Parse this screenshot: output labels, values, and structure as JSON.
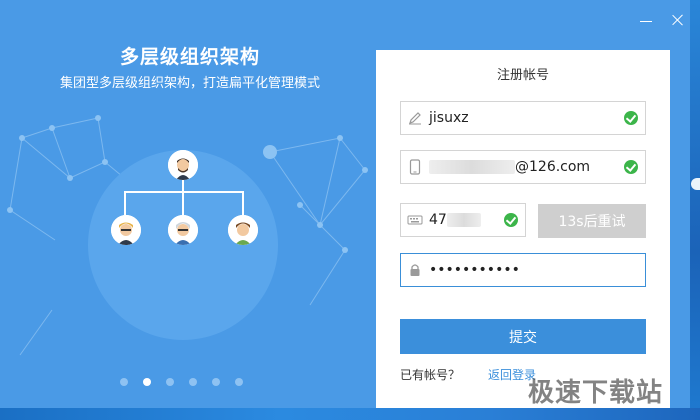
{
  "window": {
    "controls": {
      "minimize": "minimize-icon",
      "close": "close-icon"
    }
  },
  "hero": {
    "title": "多层级组织架构",
    "subtitle": "集团型多层级组织架构，打造扁平化管理模式",
    "carousel_total": 6,
    "carousel_active": 2
  },
  "form": {
    "title": "注册帐号",
    "username": {
      "value": "jisuxz",
      "icon": "pencil-icon",
      "valid": true
    },
    "email": {
      "value_suffix": "@126.com",
      "icon": "phone-icon",
      "valid": true
    },
    "code": {
      "value_prefix": "47",
      "icon": "keyboard-icon",
      "valid": true
    },
    "resend_label": "13s后重试",
    "password": {
      "value": "•••••••••••",
      "icon": "lock-icon"
    },
    "submit_label": "提交",
    "has_account_label": "已有帐号？",
    "back_login_label": "返回登录"
  },
  "watermark": "极速下载站",
  "colors": {
    "panel_bg": "#4a9ae6",
    "accent": "#3b8fdb",
    "success": "#3cb54a",
    "disabled": "#cfcfcf"
  }
}
